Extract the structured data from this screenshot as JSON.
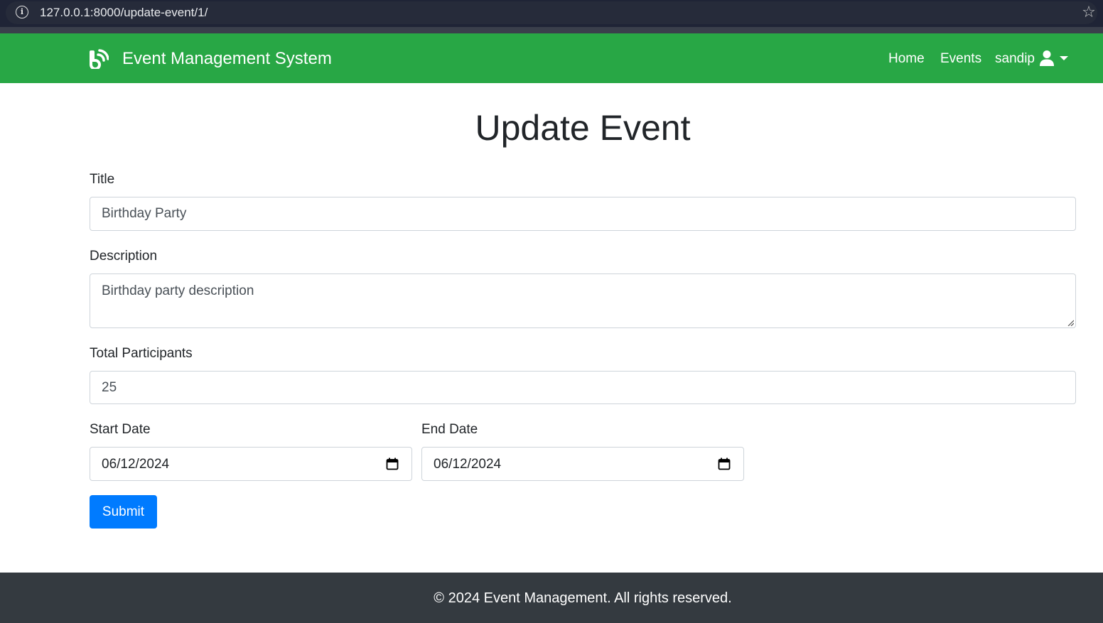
{
  "browser": {
    "url": "127.0.0.1:8000/update-event/1/",
    "info_icon": "info-icon",
    "bookmark_icon": "star-icon"
  },
  "navbar": {
    "brand_icon": "broadcast-b-icon",
    "brand": "Event Management System",
    "links": {
      "home": "Home",
      "events": "Events",
      "user": "sandip"
    },
    "user_icon": "user-icon",
    "dropdown_icon": "caret-down-icon",
    "background_color": "#28a745"
  },
  "form": {
    "heading": "Update Event",
    "title": {
      "label": "Title",
      "value": "Birthday Party"
    },
    "description": {
      "label": "Description",
      "value": "Birthday party description"
    },
    "participants": {
      "label": "Total Participants",
      "value": "25"
    },
    "start_date": {
      "label": "Start Date",
      "value": "06/12/2024"
    },
    "end_date": {
      "label": "End Date",
      "value": "06/12/2024"
    },
    "submit_label": "Submit",
    "submit_color": "#007bff"
  },
  "footer": {
    "text": "© 2024 Event Management. All rights reserved.",
    "background_color": "#343a40"
  }
}
